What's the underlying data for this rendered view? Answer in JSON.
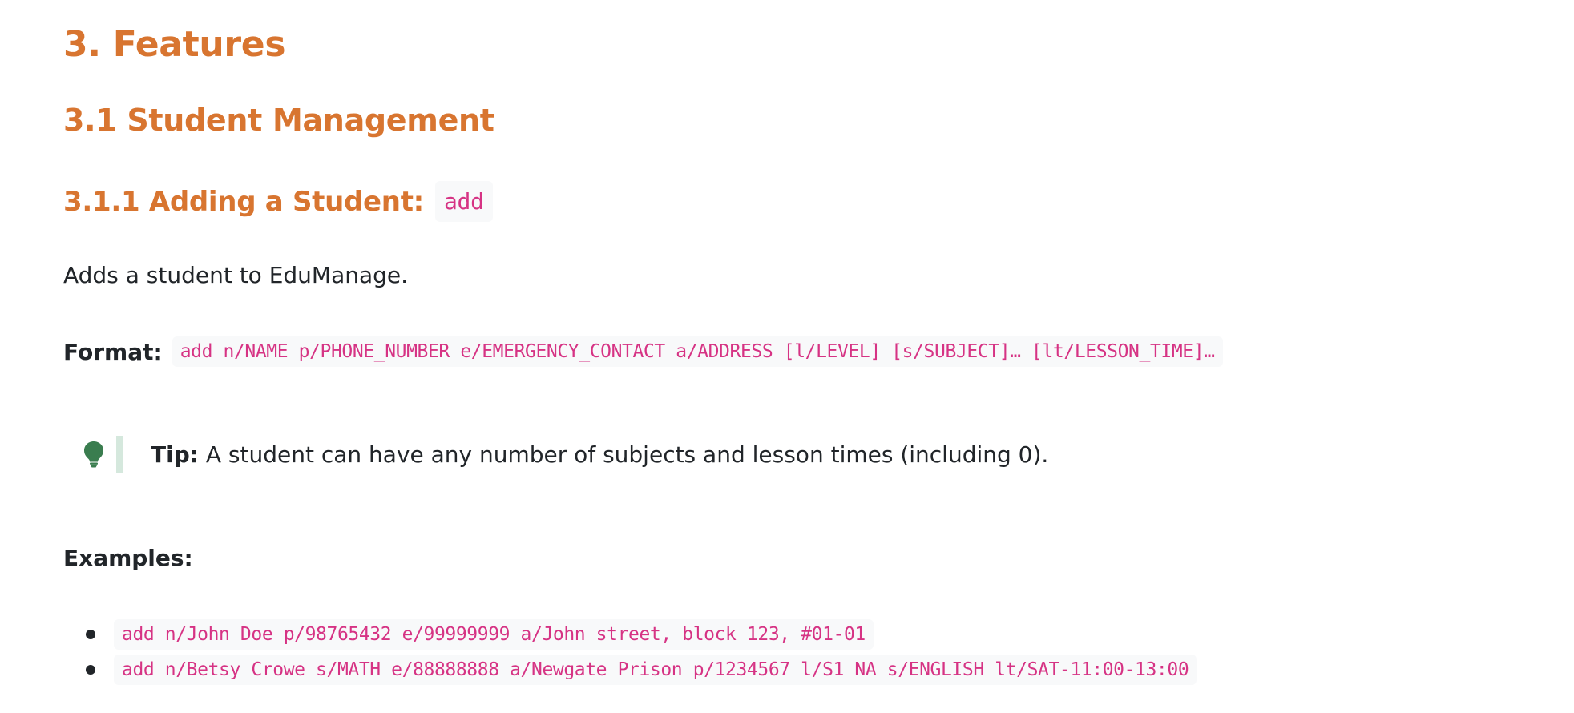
{
  "headings": {
    "h1": "3. Features",
    "h2": "3.1 Student Management",
    "h3": "3.1.1 Adding a Student:",
    "h3_code": "add"
  },
  "description": "Adds a student to EduManage.",
  "format": {
    "label": "Format:",
    "code": "add n/NAME p/PHONE_NUMBER e/EMERGENCY_CONTACT a/ADDRESS [l/LEVEL] [s/SUBJECT]… [lt/LESSON_TIME]…"
  },
  "tip": {
    "icon": "lightbulb-icon",
    "label": "Tip:",
    "text": " A student can have any number of subjects and lesson times (including 0)."
  },
  "examples": {
    "label": "Examples:",
    "items": [
      "add n/John Doe p/98765432 e/99999999 a/John street, block 123, #01-01",
      "add n/Betsy Crowe s/MATH e/88888888 a/Newgate Prison p/1234567 l/S1 NA s/ENGLISH lt/SAT-11:00-13:00"
    ]
  },
  "colors": {
    "heading": "#d87530",
    "code_text": "#d63384",
    "code_bg": "#f8f9fa",
    "tip_icon": "#3a7d4f",
    "tip_bar": "#d5e8dd"
  }
}
